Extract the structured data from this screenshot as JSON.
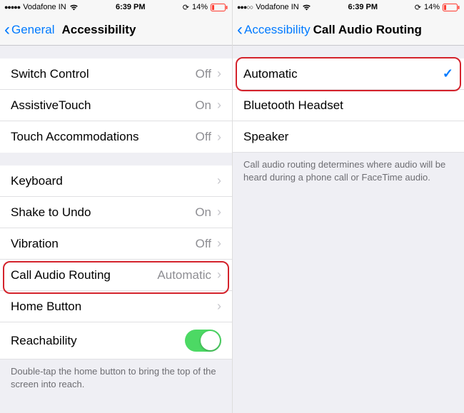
{
  "left": {
    "status": {
      "signal": "●●●●●",
      "carrier": "Vodafone IN",
      "time": "6:39 PM",
      "update_icon": "⟳",
      "battery_pct": "14%"
    },
    "nav": {
      "back": "General",
      "title": "Accessibility"
    },
    "group1": [
      {
        "label": "Switch Control",
        "value": "Off",
        "chevron": true
      },
      {
        "label": "AssistiveTouch",
        "value": "On",
        "chevron": true
      },
      {
        "label": "Touch Accommodations",
        "value": "Off",
        "chevron": true
      }
    ],
    "group2": [
      {
        "label": "Keyboard",
        "value": "",
        "chevron": true
      },
      {
        "label": "Shake to Undo",
        "value": "On",
        "chevron": true
      },
      {
        "label": "Vibration",
        "value": "Off",
        "chevron": true
      },
      {
        "label": "Call Audio Routing",
        "value": "Automatic",
        "chevron": true,
        "highlighted": true
      },
      {
        "label": "Home Button",
        "value": "",
        "chevron": true
      },
      {
        "label": "Reachability",
        "toggle": true
      }
    ],
    "footer": "Double-tap the home button to bring the top of the screen into reach."
  },
  "right": {
    "status": {
      "signal": "●●●○○",
      "carrier": "Vodafone IN",
      "time": "6:39 PM",
      "update_icon": "⟳",
      "battery_pct": "14%"
    },
    "nav": {
      "back": "Accessibility",
      "title": "Call Audio Routing"
    },
    "options": [
      {
        "label": "Automatic",
        "checked": true,
        "highlighted": true
      },
      {
        "label": "Bluetooth Headset",
        "checked": false
      },
      {
        "label": "Speaker",
        "checked": false
      }
    ],
    "footer": "Call audio routing determines where audio will be heard during a phone call or FaceTime audio."
  }
}
